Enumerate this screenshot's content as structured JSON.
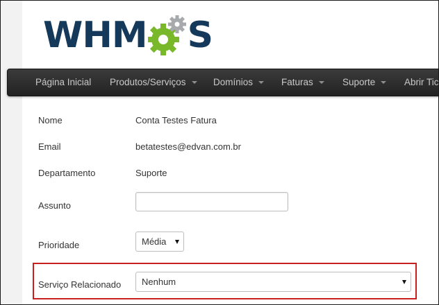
{
  "brand": {
    "logo_prefix": "WHM",
    "logo_suffix": "S",
    "colors": {
      "navy": "#15395a",
      "green": "#78b82a",
      "gray_gear": "#a7a9ac"
    }
  },
  "nav": {
    "items": [
      {
        "label": "Página Inicial",
        "dropdown": false
      },
      {
        "label": "Produtos/Serviços",
        "dropdown": true
      },
      {
        "label": "Domínios",
        "dropdown": true
      },
      {
        "label": "Faturas",
        "dropdown": true
      },
      {
        "label": "Suporte",
        "dropdown": true
      },
      {
        "label": "Abrir Tic",
        "dropdown": false
      }
    ]
  },
  "form": {
    "name_label": "Nome",
    "name_value": "Conta Testes Fatura",
    "email_label": "Email",
    "email_value": "betatestes@edvan.com.br",
    "department_label": "Departamento",
    "department_value": "Suporte",
    "subject_label": "Assunto",
    "subject_value": "",
    "priority_label": "Prioridade",
    "priority_value": "Média",
    "service_label": "Serviço Relacionado",
    "service_value": "Nenhum"
  },
  "highlight_color": "#c81e1e"
}
